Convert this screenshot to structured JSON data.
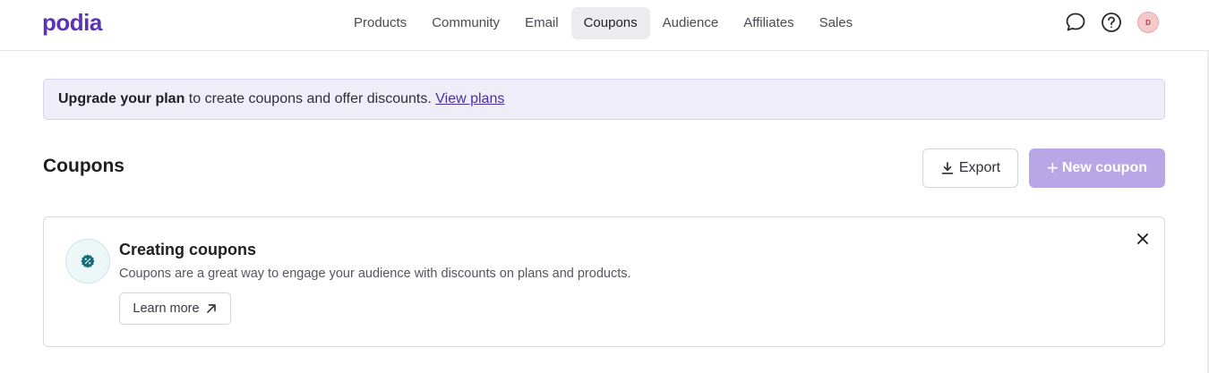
{
  "brand": {
    "logo_text": "podia",
    "accent": "#5a33b8"
  },
  "nav": {
    "items": [
      {
        "label": "Products"
      },
      {
        "label": "Community"
      },
      {
        "label": "Email"
      },
      {
        "label": "Coupons",
        "active": true
      },
      {
        "label": "Audience"
      },
      {
        "label": "Affiliates"
      },
      {
        "label": "Sales"
      }
    ]
  },
  "header_icons": {
    "chat": "chat-bubble-icon",
    "help": "help-circle-icon",
    "avatar_initial": "D"
  },
  "banner": {
    "strong_text": "Upgrade your plan",
    "text": " to create coupons and offer discounts. ",
    "link_text": "View plans"
  },
  "page": {
    "title": "Coupons"
  },
  "actions": {
    "export_label": "Export",
    "export_icon": "download-icon",
    "new_coupon_label": "New coupon",
    "new_coupon_icon": "plus-icon"
  },
  "info_card": {
    "icon": "coupon-badge-icon",
    "title": "Creating coupons",
    "description": "Coupons are a great way to engage your audience with discounts on plans and products.",
    "learn_more_label": "Learn more",
    "learn_more_icon": "arrow-up-right-icon",
    "close_icon": "close-icon"
  }
}
